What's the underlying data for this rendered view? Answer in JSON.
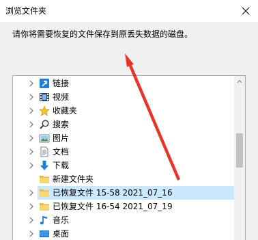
{
  "window": {
    "title": "浏览文件夹",
    "close_icon": "close-icon"
  },
  "instruction": "请你将需要恢复的文件保存到原丢失数据的磁盘。",
  "tree": {
    "items": [
      {
        "label": "链接",
        "icon": "link-icon",
        "has_children": true
      },
      {
        "label": "视频",
        "icon": "video-folder-icon",
        "has_children": true
      },
      {
        "label": "收藏夹",
        "icon": "star-icon",
        "has_children": true
      },
      {
        "label": "搜索",
        "icon": "search-icon",
        "has_children": true
      },
      {
        "label": "图片",
        "icon": "pictures-folder-icon",
        "has_children": true
      },
      {
        "label": "文档",
        "icon": "documents-folder-icon",
        "has_children": true
      },
      {
        "label": "下载",
        "icon": "download-arrow-icon",
        "has_children": true
      },
      {
        "label": "新建文件夹",
        "icon": "folder-icon",
        "has_children": false
      },
      {
        "label": "已恢复文件 15-58 2021_07_16",
        "icon": "folder-icon",
        "has_children": true,
        "selected": true
      },
      {
        "label": "已恢复文件 16-54 2021_07_19",
        "icon": "folder-icon",
        "has_children": true
      },
      {
        "label": "音乐",
        "icon": "music-note-icon",
        "has_children": true
      },
      {
        "label": "桌面",
        "icon": "desktop-icon",
        "has_children": true
      }
    ]
  },
  "colors": {
    "selection": "#cce8ff",
    "arrow": "#e8352b",
    "folder": "#f8d775",
    "accent_blue": "#1e7fd6"
  }
}
